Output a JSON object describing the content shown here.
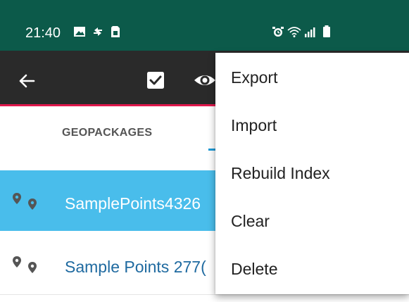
{
  "status_bar": {
    "time": "21:40",
    "icons_left": [
      "image-icon",
      "sync-icon",
      "sim-icon"
    ],
    "icons_right": [
      "alarm-icon",
      "wifi-icon",
      "signal-icon",
      "battery-icon"
    ]
  },
  "app_bar": {
    "icons": [
      "back-arrow-icon",
      "checkbox-icon",
      "eye-icon"
    ]
  },
  "tabs": [
    {
      "label": "GEOPACKAGES"
    }
  ],
  "list": [
    {
      "label": "SamplePoints4326",
      "icon": "map-pins-icon",
      "selected": true
    },
    {
      "label": "Sample Points 277(",
      "icon": "map-pins-icon",
      "selected": false
    }
  ],
  "menu": {
    "items": [
      "Export",
      "Import",
      "Rebuild Index",
      "Clear",
      "Delete"
    ]
  },
  "colors": {
    "status_bar": "#0c5a4a",
    "app_bar": "#2a2a2a",
    "accent": "#e0184c",
    "tab_indicator": "#1e9ad6",
    "selected_row": "#49bdeb",
    "row_text": "#1f6aa0"
  }
}
